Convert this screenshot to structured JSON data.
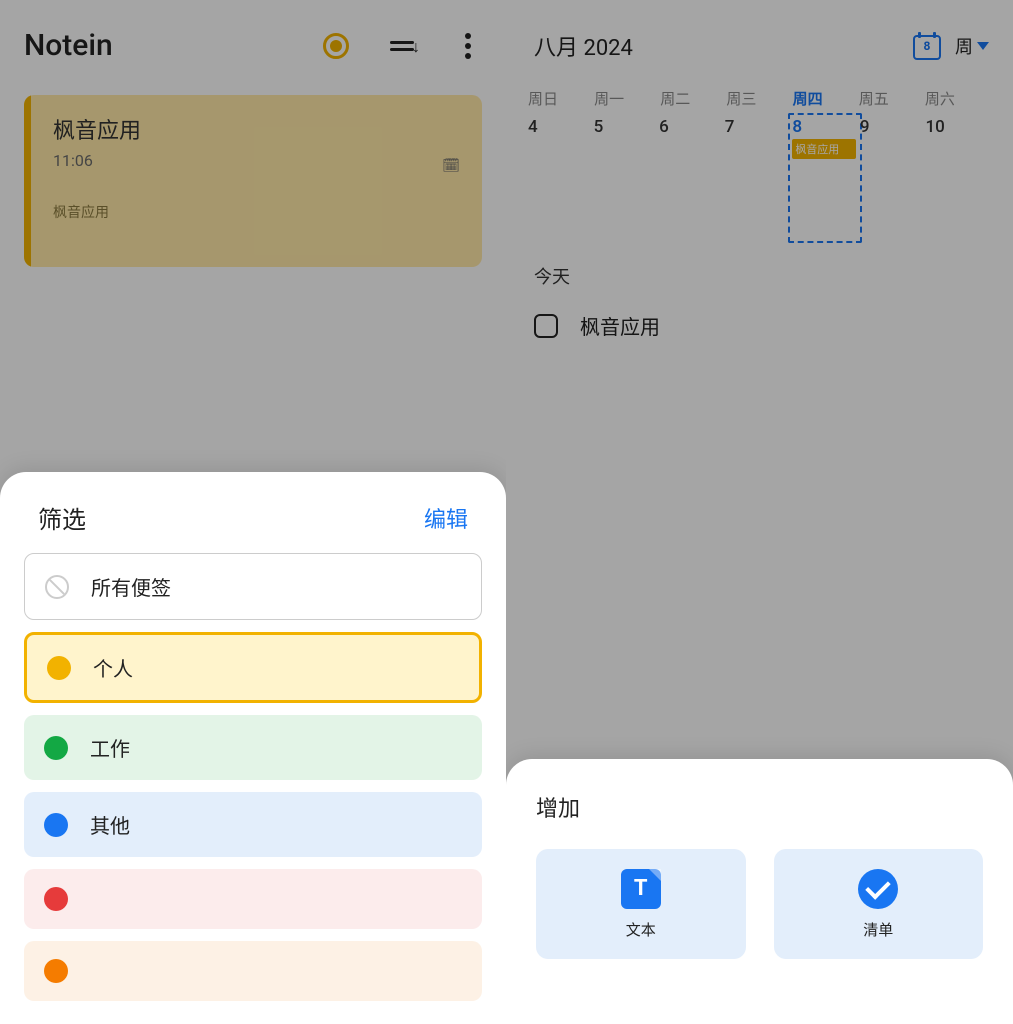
{
  "left": {
    "app_title": "Notein",
    "note": {
      "title": "枫音应用",
      "time": "11:06",
      "sub": "枫音应用"
    },
    "sheet": {
      "title": "筛选",
      "edit": "编辑",
      "items": {
        "all": "所有便签",
        "personal": "个人",
        "work": "工作",
        "other": "其他"
      }
    }
  },
  "right": {
    "month": "八月 2024",
    "cal_day": "8",
    "view": "周",
    "weekdays": [
      "周日",
      "周一",
      "周二",
      "周三",
      "周四",
      "周五",
      "周六"
    ],
    "dates": [
      "4",
      "5",
      "6",
      "7",
      "8",
      "9",
      "10"
    ],
    "event_chip": "枫音应用",
    "today_label": "今天",
    "task": "枫音应用",
    "sheet": {
      "title": "增加",
      "text_opt": "文本",
      "list_opt": "清单"
    }
  }
}
